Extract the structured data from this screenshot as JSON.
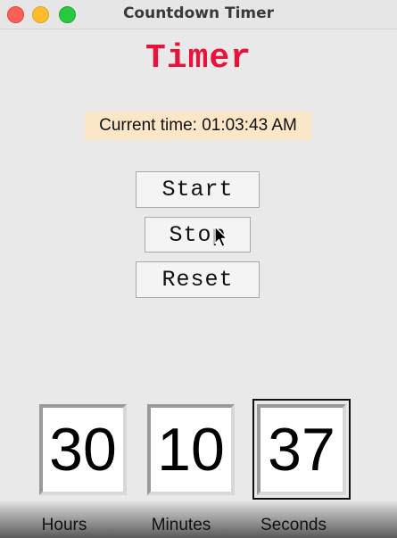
{
  "window": {
    "title": "Countdown Timer"
  },
  "app": {
    "heading": "Timer",
    "current_time_label": "Current time: 01:03:43 AM"
  },
  "buttons": {
    "start": "Start",
    "stop": "Stop",
    "reset": "Reset"
  },
  "display": {
    "hours": "30",
    "minutes": "10",
    "seconds": "37",
    "hours_label": "Hours",
    "minutes_label": "Minutes",
    "seconds_label": "Seconds"
  },
  "colors": {
    "heading": "#e8123a",
    "current_time_bg": "#fbe7c7",
    "close": "#fe5f57",
    "minimize": "#febc2e",
    "zoom": "#28c840"
  }
}
